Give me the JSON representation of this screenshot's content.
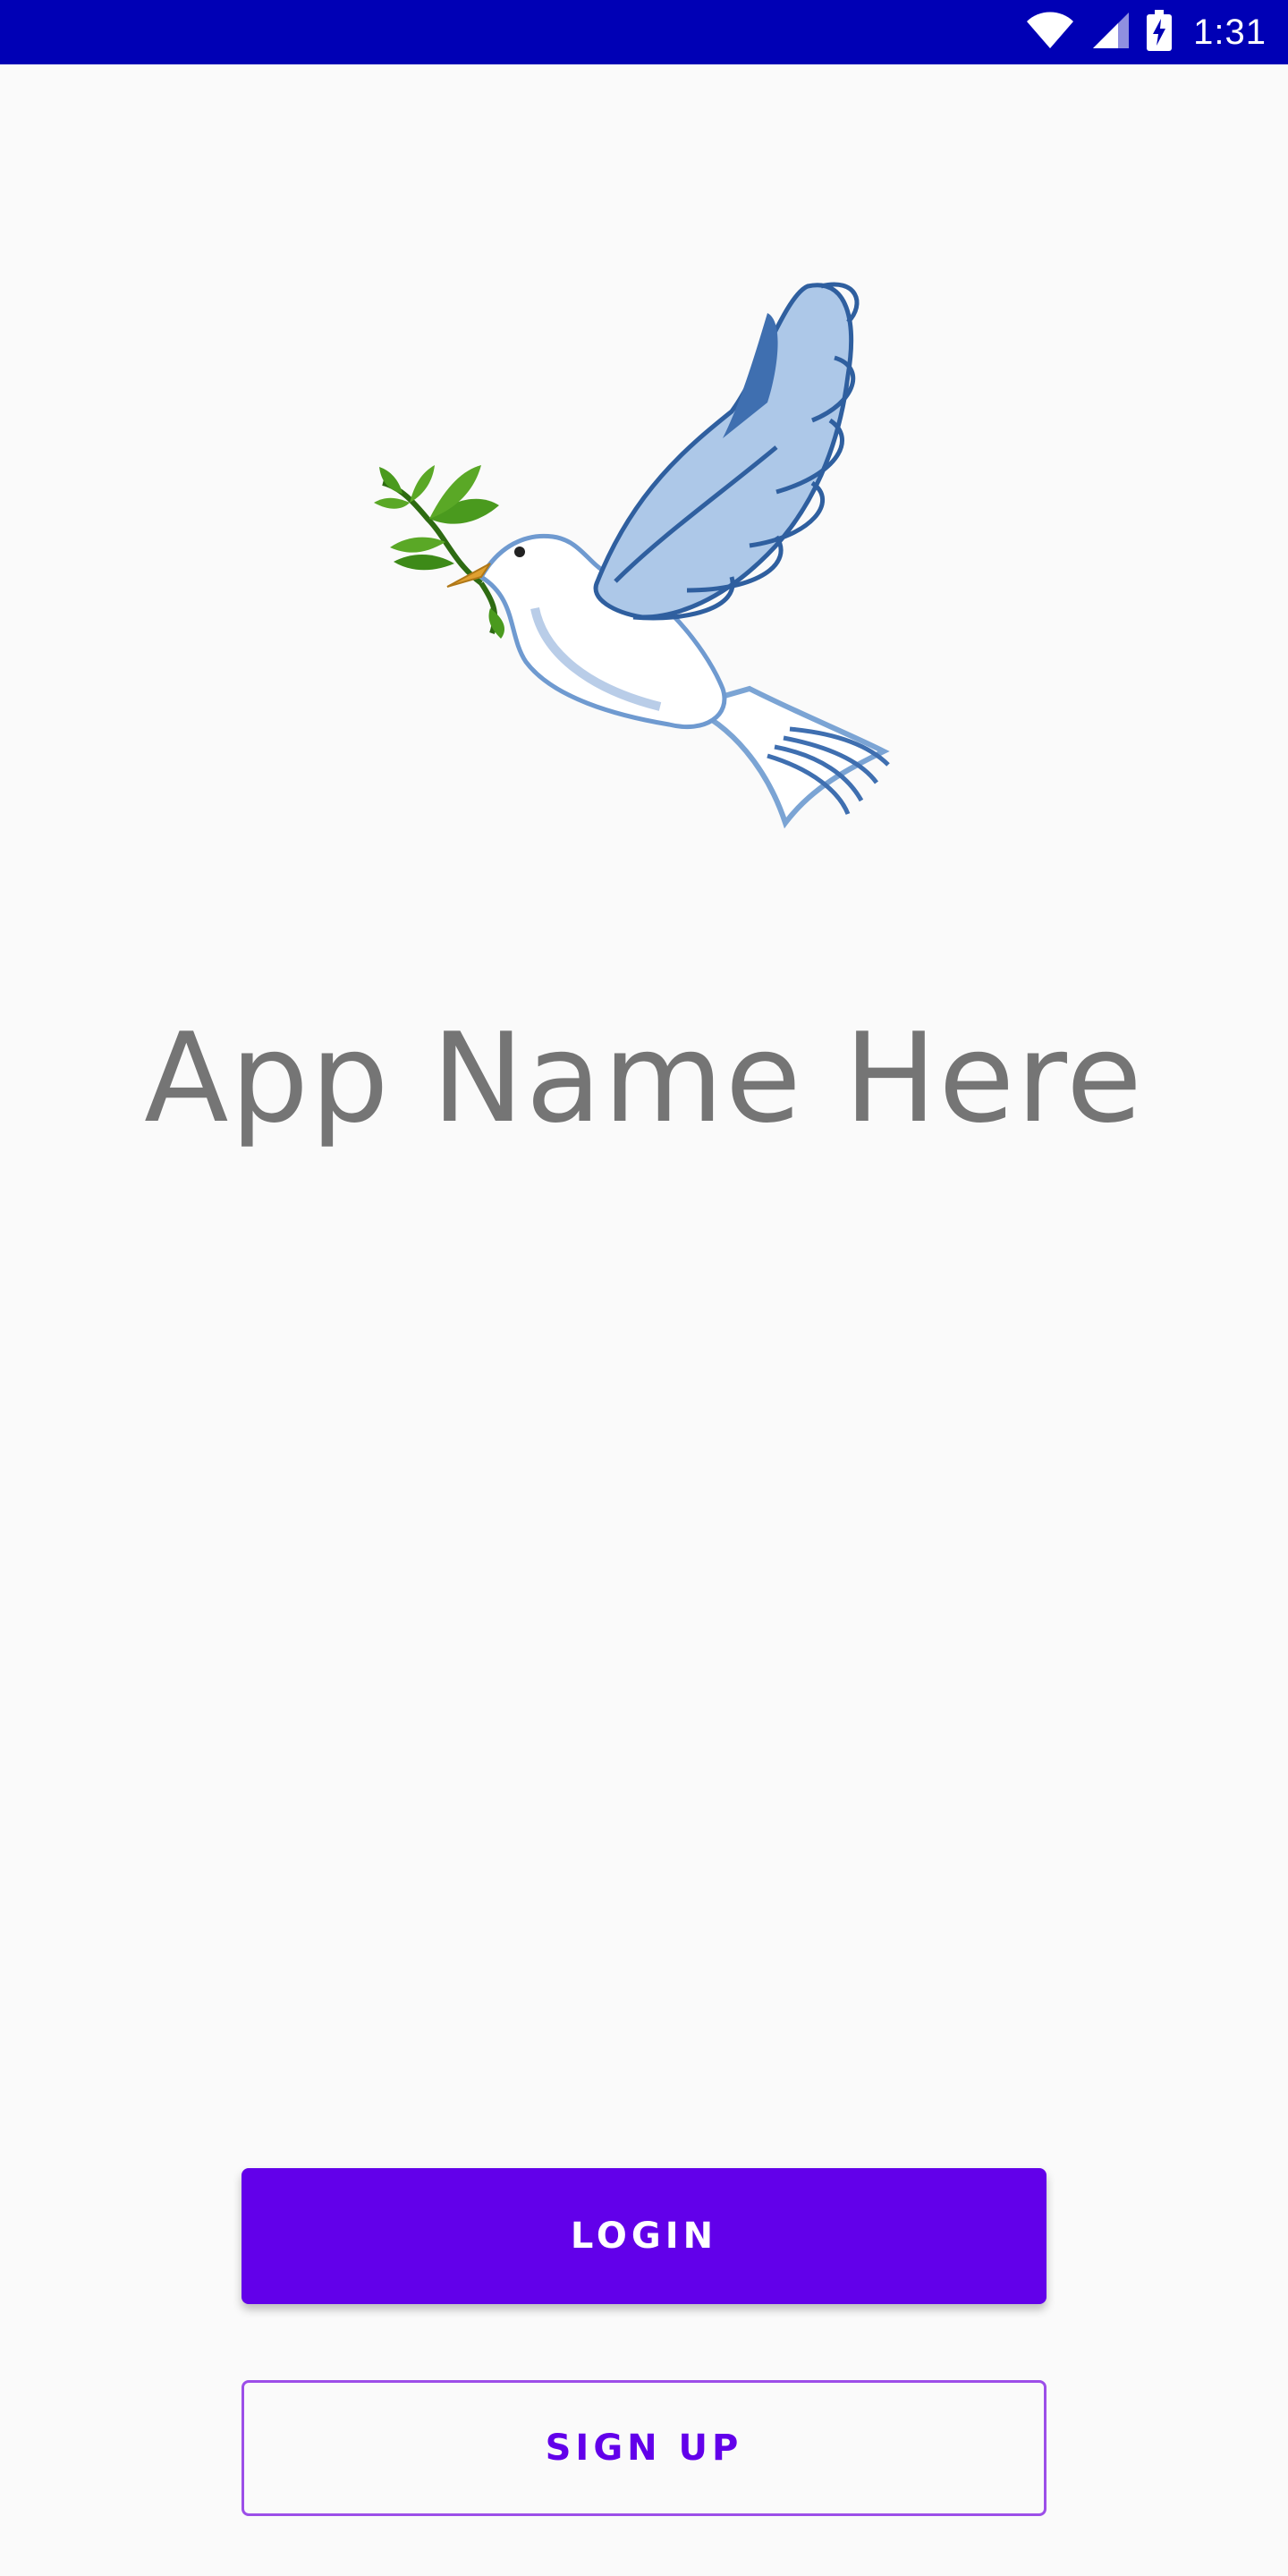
{
  "status_bar": {
    "time": "1:31",
    "icons": [
      "wifi-icon",
      "cell-signal-icon",
      "battery-charging-icon"
    ],
    "background": "#0000b5"
  },
  "logo": {
    "icon": "dove-with-olive-branch-icon"
  },
  "app_name": "App Name Here",
  "buttons": {
    "login_label": "LOGIN",
    "signup_label": "SIGN UP"
  },
  "colors": {
    "accent": "#6200ea",
    "title_text": "#757575",
    "background": "#fafafa"
  }
}
